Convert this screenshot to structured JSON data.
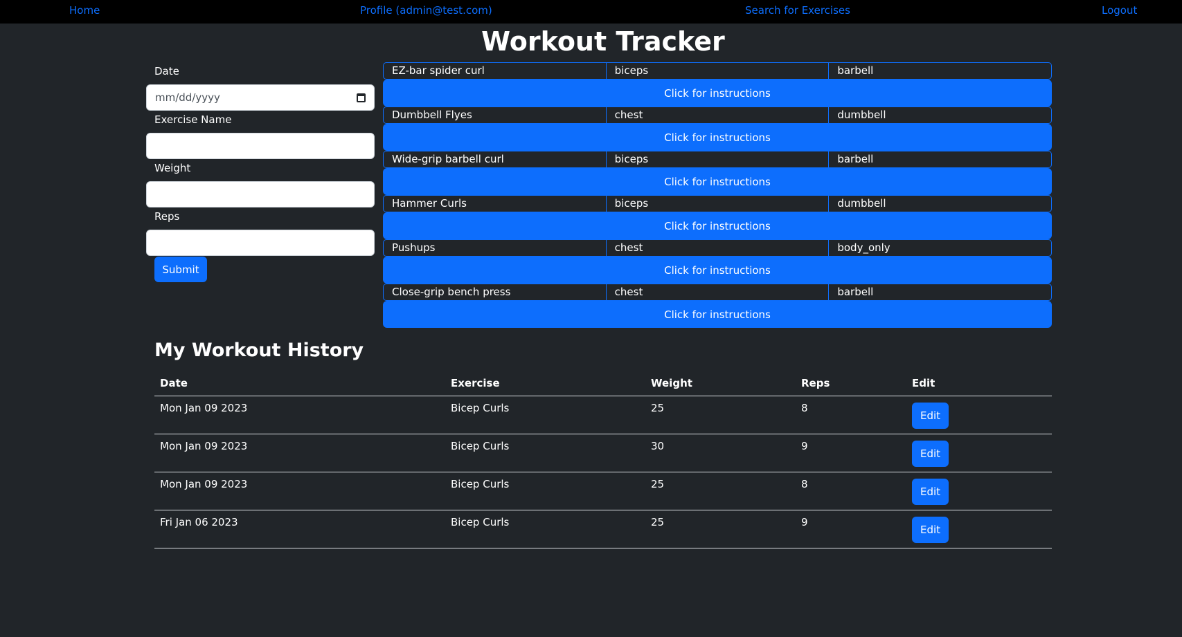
{
  "nav": {
    "home": "Home",
    "profile": "Profile (admin@test.com)",
    "search": "Search for Exercises",
    "logout": "Logout"
  },
  "title": "Workout Tracker",
  "form": {
    "date_label": "Date",
    "date_placeholder": "mm/dd/yyyy",
    "exercise_label": "Exercise Name",
    "weight_label": "Weight",
    "reps_label": "Reps",
    "submit_label": "Submit"
  },
  "exercises": [
    {
      "name": "EZ-bar spider curl",
      "muscle": "biceps",
      "equipment": "barbell",
      "button": "Click for instructions"
    },
    {
      "name": "Dumbbell Flyes",
      "muscle": "chest",
      "equipment": "dumbbell",
      "button": "Click for instructions"
    },
    {
      "name": "Wide-grip barbell curl",
      "muscle": "biceps",
      "equipment": "barbell",
      "button": "Click for instructions"
    },
    {
      "name": "Hammer Curls",
      "muscle": "biceps",
      "equipment": "dumbbell",
      "button": "Click for instructions"
    },
    {
      "name": "Pushups",
      "muscle": "chest",
      "equipment": "body_only",
      "button": "Click for instructions"
    },
    {
      "name": "Close-grip bench press",
      "muscle": "chest",
      "equipment": "barbell",
      "button": "Click for instructions"
    }
  ],
  "history": {
    "title": "My Workout History",
    "columns": [
      "Date",
      "Exercise",
      "Weight",
      "Reps",
      "Edit"
    ],
    "rows": [
      {
        "date": "Mon Jan 09 2023",
        "exercise": "Bicep Curls",
        "weight": "25",
        "reps": "8",
        "edit": "Edit"
      },
      {
        "date": "Mon Jan 09 2023",
        "exercise": "Bicep Curls",
        "weight": "30",
        "reps": "9",
        "edit": "Edit"
      },
      {
        "date": "Mon Jan 09 2023",
        "exercise": "Bicep Curls",
        "weight": "25",
        "reps": "8",
        "edit": "Edit"
      },
      {
        "date": "Fri Jan 06 2023",
        "exercise": "Bicep Curls",
        "weight": "25",
        "reps": "9",
        "edit": "Edit"
      }
    ]
  },
  "colors": {
    "background": "#212529",
    "nav_background": "#000000",
    "primary": "#0d6efd"
  }
}
